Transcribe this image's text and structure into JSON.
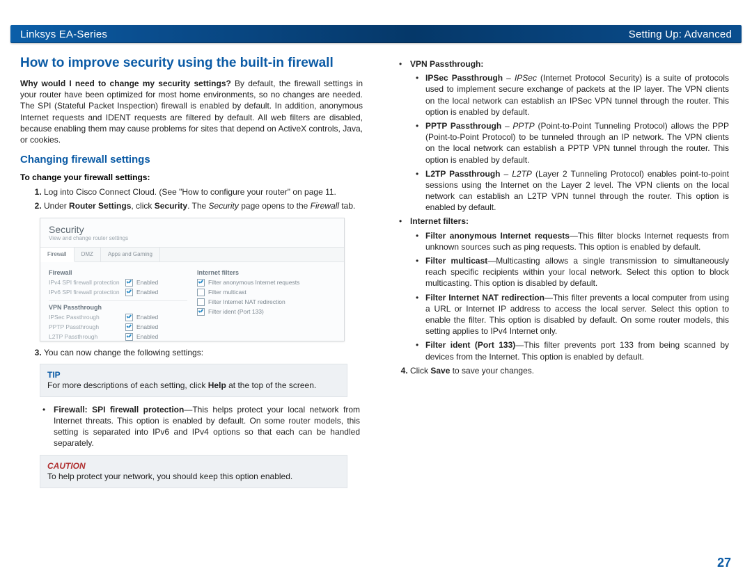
{
  "header": {
    "left": "Linksys EA-Series",
    "right": "Setting Up: Advanced"
  },
  "page_number": "27",
  "left_col": {
    "h1": "How to improve security using the built-in firewall",
    "intro": {
      "q": "Why would I need to change my security settings?",
      "a": " By default, the firewall settings in your router have been optimized for most home environments, so no changes are needed. The SPI (Stateful Packet Inspection) firewall is enabled by default. In addition, anonymous Internet requests and IDENT requests are filtered by default. All web filters are disabled, because enabling them may cause problems for sites that depend on ActiveX controls, Java, or cookies."
    },
    "h2": "Changing firewall settings",
    "sub_heading": "To change your firewall settings:",
    "step1": "Log into Cisco Connect Cloud. (See \"How to configure your router\" on page 11.",
    "step2": {
      "pre": "Under ",
      "b1": "Router Settings",
      "mid": ", click ",
      "b2": "Security",
      "post1": ". The ",
      "it1": "Security",
      "post2": " page opens to the ",
      "it2": "Firewall",
      "post3": " tab."
    },
    "step3": "You can now change the following settings:",
    "tip": {
      "title": "TIP",
      "pre": "For more descriptions of each setting, click ",
      "b": "Help",
      "post": " at the top of the screen."
    },
    "bullet_firewall": {
      "b": "Firewall: SPI firewall protection",
      "t": "—This helps protect your local network from Internet threats. This option is enabled by default. On some router models, this setting is separated into IPv6 and IPv4 options so that each can be handled separately."
    },
    "caution": {
      "title": "CAUTION",
      "body": "To help protect your network, you should keep this option enabled."
    },
    "ui": {
      "title": "Security",
      "subtitle": "View and change router settings",
      "tabs": [
        "Firewall",
        "DMZ",
        "Apps and Gaming"
      ],
      "left_head": "Firewall",
      "rows_l": [
        {
          "l": "IPv4 SPI firewall protection",
          "v": "Enabled"
        },
        {
          "l": "IPv6 SPI firewall protection",
          "v": "Enabled"
        }
      ],
      "vpn_head": "VPN Passthrough",
      "rows_v": [
        {
          "l": "IPSec Passthrough",
          "v": "Enabled"
        },
        {
          "l": "PPTP Passthrough",
          "v": "Enabled"
        },
        {
          "l": "L2TP Passthrough",
          "v": "Enabled"
        }
      ],
      "right_head": "Internet filters",
      "rows_r": [
        {
          "l": "Filter anonymous Internet requests",
          "on": true
        },
        {
          "l": "Filter multicast",
          "on": false
        },
        {
          "l": "Filter Internet NAT redirection",
          "on": false
        },
        {
          "l": "Filter ident (Port 133)",
          "on": true
        }
      ]
    }
  },
  "right_col": {
    "vpn_head": "VPN Passthrough:",
    "vpn_items": [
      {
        "b": "IPSec Passthrough",
        "dash": " – ",
        "it": "IPSec",
        "t": " (Internet Protocol Security) is a suite of protocols used to implement secure exchange of packets at the IP layer. The VPN clients on the local network can establish an IPSec VPN tunnel through the router. This option is enabled by default."
      },
      {
        "b": "PPTP Passthrough",
        "dash": " – ",
        "it": "PPTP",
        "t": " (Point-to-Point Tunneling Protocol) allows the PPP (Point-to-Point Protocol) to be tunneled through an IP network. The VPN clients on the local network can establish a PPTP VPN tunnel through the router. This option is enabled by default."
      },
      {
        "b": "L2TP Passthrough",
        "dash": " – ",
        "it": "L2TP",
        "t": " (Layer 2 Tunneling Protocol) enables point-to-point sessions using the Internet on the Layer 2 level. The VPN clients on the local network can establish an L2TP VPN tunnel through the router. This option is enabled by default."
      }
    ],
    "if_head": "Internet filters:",
    "if_items": [
      {
        "b": "Filter anonymous Internet requests",
        "t": "—This filter blocks Internet requests from unknown sources such as ping requests. This option is enabled by default."
      },
      {
        "b": "Filter multicast",
        "t": "—Multicasting allows a single transmission to simultaneously reach specific recipients within your local network. Select this option to block multicasting. This option is disabled by default."
      },
      {
        "b": "Filter Internet NAT redirection",
        "t": "—This filter prevents a local computer from using a URL or Internet IP address to access the local server. Select this option to enable the filter. This option is disabled by default. On some router models, this setting applies to IPv4 Internet only."
      },
      {
        "b": "Filter ident (Port 133)",
        "t": "—This filter prevents port 133 from being scanned by devices from the Internet. This option is enabled by default."
      }
    ],
    "step4": {
      "pre": "Click ",
      "b": "Save",
      "post": " to save your changes."
    }
  }
}
